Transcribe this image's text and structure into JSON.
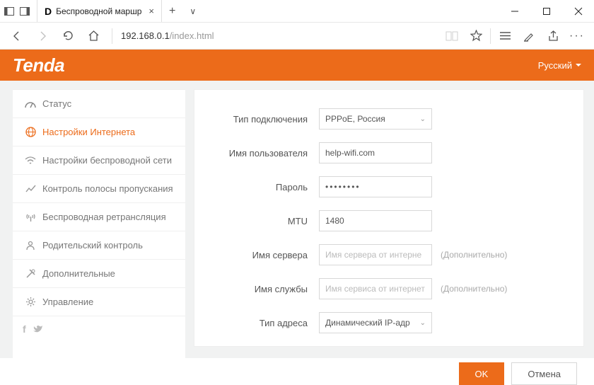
{
  "browser": {
    "tab_title": "Беспроводной маршр",
    "url_host": "192.168.0.1",
    "url_path": "/index.html"
  },
  "header": {
    "brand": "Tenda",
    "language": "Русский"
  },
  "sidebar": {
    "items": [
      {
        "label": "Статус"
      },
      {
        "label": "Настройки Интернета"
      },
      {
        "label": "Настройки беспроводной сети"
      },
      {
        "label": "Контроль полосы пропускания"
      },
      {
        "label": "Беспроводная ретрансляция"
      },
      {
        "label": "Родительский контроль"
      },
      {
        "label": "Дополнительные"
      },
      {
        "label": "Управление"
      }
    ]
  },
  "form": {
    "connection_type_label": "Тип подключения",
    "connection_type_value": "PPPoE, Россия",
    "username_label": "Имя пользователя",
    "username_value": "help-wifi.com",
    "password_label": "Пароль",
    "password_value": "••••••••",
    "mtu_label": "MTU",
    "mtu_value": "1480",
    "server_name_label": "Имя сервера",
    "server_name_placeholder": "Имя сервера от интерне",
    "service_name_label": "Имя службы",
    "service_name_placeholder": "Имя сервиса от интернет",
    "optional_text": "(Дополнительно)",
    "address_type_label": "Тип адреса",
    "address_type_value": "Динамический IP-адр"
  },
  "buttons": {
    "ok": "OK",
    "cancel": "Отмена"
  }
}
